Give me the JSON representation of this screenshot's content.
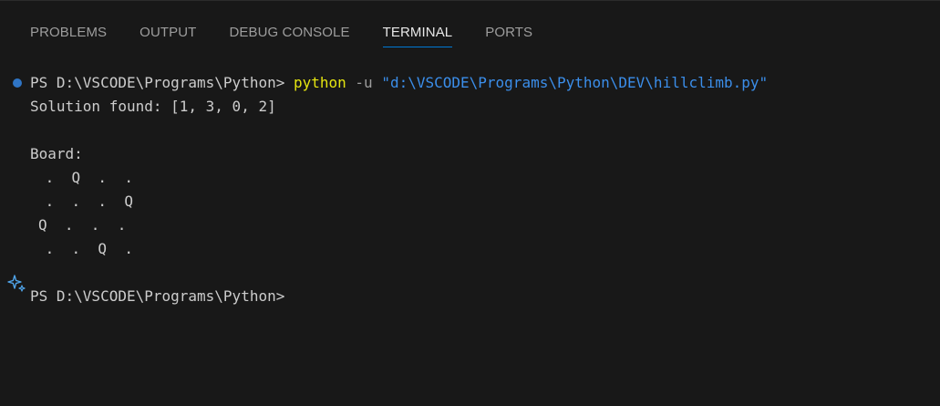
{
  "tabs": [
    {
      "label": "PROBLEMS"
    },
    {
      "label": "OUTPUT"
    },
    {
      "label": "DEBUG CONSOLE"
    },
    {
      "label": "TERMINAL",
      "active": true
    },
    {
      "label": "PORTS"
    }
  ],
  "terminal": {
    "prompt1": "PS D:\\VSCODE\\Programs\\Python> ",
    "command": "python",
    "flag": " -u ",
    "path_arg": "\"d:\\VSCODE\\Programs\\Python\\DEV\\hillclimb.py\"",
    "solution_line": "Solution found: [1, 3, 0, 2]",
    "board_label": "Board:",
    "board_rows": [
      " .  Q  .  .",
      " .  .  .  Q",
      "Q  .  .  .",
      " .  .  Q  ."
    ],
    "prompt2": "PS D:\\VSCODE\\Programs\\Python>"
  },
  "icons": {
    "status_dot": "circle-status-icon",
    "sparkle": "sparkle-icon"
  },
  "colors": {
    "background": "#181818",
    "tab_active_underline": "#0078d4",
    "command": "#e5e510",
    "string": "#3b8eea",
    "status_dot": "#3794ff"
  }
}
